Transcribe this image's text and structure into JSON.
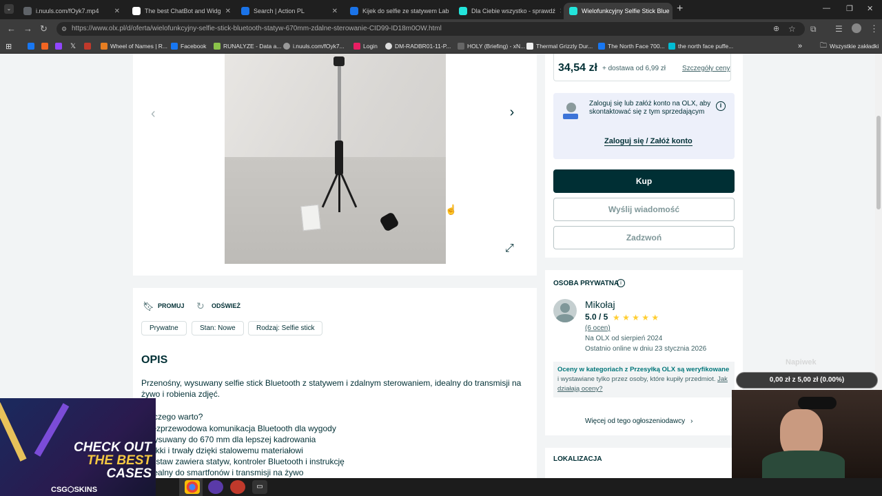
{
  "tabs": [
    {
      "title": "i.nuuls.com/fOyk7.mp4",
      "color": "#5f6368"
    },
    {
      "title": "The best ChatBot and Widg",
      "color": "#ffffff"
    },
    {
      "title": "Search | Action PL",
      "color": "#1a73e8"
    },
    {
      "title": "Kijek do selfie ze statywem Lab",
      "color": "#1a73e8"
    },
    {
      "title": "Dla Ciebie wszystko - sprawdź",
      "color": "#23e5db"
    },
    {
      "title": "Wielofunkcyjny Selfie Stick Blue",
      "color": "#23e5db"
    }
  ],
  "new_tab": "+",
  "url": "https://www.olx.pl/d/oferta/wielofunkcyjny-selfie-stick-bluetooth-statyw-670mm-zdalne-sterowanie-CID99-ID18m0OW.html",
  "bookmarks": [
    "Wheel of Names | R...",
    "Facebook",
    "RUNALYZE - Data a...",
    "i.nuuls.com/fOyk7...",
    "Login",
    "DM-RADBR01-11-P...",
    "HOLY (Briefing) - xN...",
    "Thermal Grizzly Dur...",
    "The North Face 700...",
    "the north face puffe..."
  ],
  "bookmarks_folder": "Wszystkie zakładki",
  "price": {
    "value": "34,54 zł",
    "delivery": "+ dostawa od 6,99 zł",
    "details": "Szczegóły ceny"
  },
  "login_box": {
    "text": "Zaloguj się lub załóż konto na OLX, aby skontaktować się z tym sprzedającym",
    "link": "Zaloguj się / Załóż konto"
  },
  "buttons": {
    "buy": "Kup",
    "message": "Wyślij wiadomość",
    "call": "Zadzwoń"
  },
  "actions": {
    "promote": "PROMUJ",
    "refresh": "ODŚWIEŻ"
  },
  "tags": [
    "Prywatne",
    "Stan: Nowe",
    "Rodzaj: Selfie stick"
  ],
  "description": {
    "heading": "OPIS",
    "intro": "Przenośny, wysuwany selfie stick Bluetooth z statywem i zdalnym sterowaniem, idealny do transmisji na żywo i robienia zdjęć.",
    "why": "Dlaczego warto?",
    "bullets": [
      "- Bezprzewodowa komunikacja Bluetooth dla wygody",
      "- Wysuwany do 670 mm dla lepszej kadrowania",
      "- Lekki i trwały dzięki stalowemu materiałowi",
      "- Zestaw zawiera statyw, kontroler Bluetooth i instrukcję",
      "- Idealny do smartfonów i transmisji na żywo"
    ]
  },
  "seller": {
    "section": "OSOBA PRYWATNA",
    "name": "Mikołaj",
    "rating": "5.0 / 5",
    "stars": 5,
    "reviews": "(6 ocen)",
    "since": "Na OLX od sierpień 2024",
    "online": "Ostatnio online w dniu 23 stycznia 2026",
    "verified_bold": "Oceny w kategoriach z Przesyłką OLX są weryfikowane",
    "verified_rest": " i wystawiane tylko przez osoby, które kupiły przedmiot.",
    "verified_link": "Jak działają oceny?",
    "more": "Więcej od tego ogłoszeniodawcy"
  },
  "location": "LOKALIZACJA",
  "overlay": {
    "ad_line1": "CHECK OUT",
    "ad_line2": "THE BEST",
    "ad_line3": "CASES",
    "ad_brand": "CSG⬡SKINS",
    "napiwek": "Napiwek",
    "tip_bar": "0,00 zł z 5,00 zł (0.00%)"
  },
  "colors": {
    "olx_dark": "#002f34",
    "accent": "#23e5db",
    "tip_green": "#52d452"
  }
}
